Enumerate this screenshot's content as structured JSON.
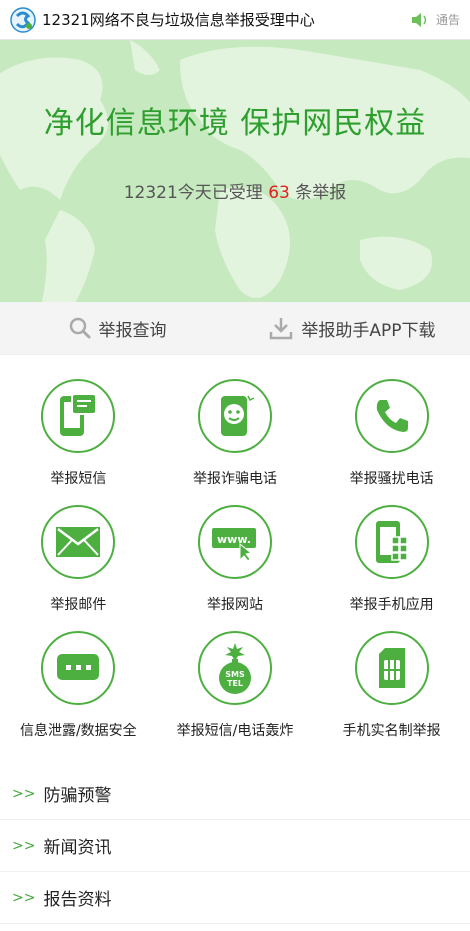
{
  "header": {
    "site_title": "12321网络不良与垃圾信息举报受理中心",
    "notice_label": "通告"
  },
  "hero": {
    "slogan": "净化信息环境 保护网民权益",
    "count_prefix": "12321今天已受理",
    "count": "63",
    "count_suffix": "条举报"
  },
  "actions": [
    {
      "label": "举报查询",
      "icon": "search-icon"
    },
    {
      "label": "举报助手APP下载",
      "icon": "download-icon"
    }
  ],
  "grid": [
    {
      "label": "举报短信",
      "icon": "sms-phone-icon"
    },
    {
      "label": "举报诈骗电话",
      "icon": "fraud-phone-icon"
    },
    {
      "label": "举报骚扰电话",
      "icon": "handset-icon"
    },
    {
      "label": "举报邮件",
      "icon": "envelope-icon"
    },
    {
      "label": "举报网站",
      "icon": "www-icon"
    },
    {
      "label": "举报手机应用",
      "icon": "app-phone-icon"
    },
    {
      "label": "信息泄露/数据安全",
      "icon": "chat-dots-icon"
    },
    {
      "label": "举报短信/电话轰炸",
      "icon": "bomb-icon"
    },
    {
      "label": "手机实名制举报",
      "icon": "sim-card-icon"
    }
  ],
  "links": [
    {
      "arrow": ">>",
      "label": "防骗预警"
    },
    {
      "arrow": ">>",
      "label": "新闻资讯"
    },
    {
      "arrow": ">>",
      "label": "报告资料"
    }
  ],
  "colors": {
    "accent": "#4caf40",
    "hero_bg": "#c7e9bf",
    "count": "#e02020"
  }
}
